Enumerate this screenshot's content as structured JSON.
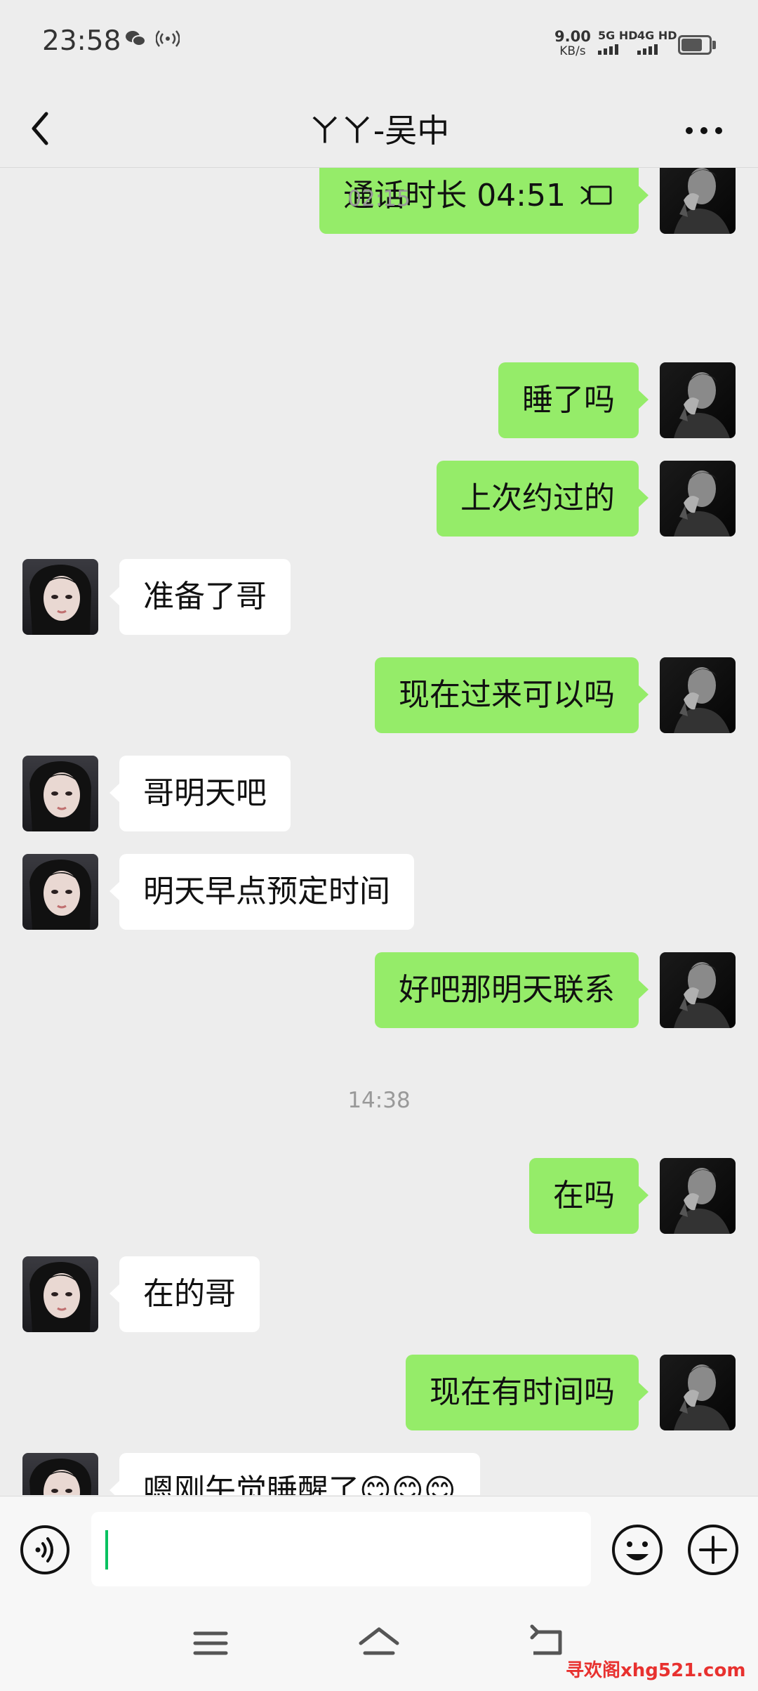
{
  "status_bar": {
    "time": "23:58",
    "net_speed_value": "9.00",
    "net_speed_unit": "KB/s",
    "sim1_label": "5G HD",
    "sim2_label": "4G HD",
    "battery_percent": 75
  },
  "header": {
    "title": "ㄚㄚ-吴中"
  },
  "messages": [
    {
      "side": "me",
      "text": "通话时长 04:51",
      "icon": "voice-call-icon"
    },
    {
      "type": "time",
      "text": "02:15"
    },
    {
      "side": "me",
      "text": "睡了吗"
    },
    {
      "side": "me",
      "text": "上次约过的"
    },
    {
      "side": "them",
      "text": "准备了哥"
    },
    {
      "side": "me",
      "text": "现在过来可以吗"
    },
    {
      "side": "them",
      "text": "哥明天吧"
    },
    {
      "side": "them",
      "text": "明天早点预定时间"
    },
    {
      "side": "me",
      "text": "好吧那明天联系"
    },
    {
      "type": "time",
      "text": "14:38"
    },
    {
      "side": "me",
      "text": "在吗"
    },
    {
      "side": "them",
      "text": "在的哥"
    },
    {
      "side": "me",
      "text": "现在有时间吗"
    },
    {
      "side": "them",
      "text": "嗯刚午觉睡醒了😊😊😊"
    }
  ],
  "input": {
    "value": ""
  },
  "watermark": "寻欢阁xhg521.com",
  "colors": {
    "background": "#ededed",
    "my_bubble": "#95ec69",
    "their_bubble": "#ffffff",
    "caret": "#07c160"
  }
}
